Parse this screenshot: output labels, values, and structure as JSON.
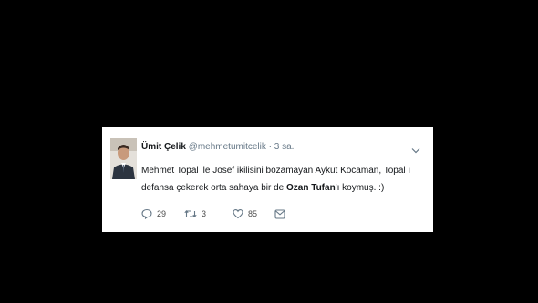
{
  "tweet": {
    "display_name": "Ümit Çelik",
    "handle": "@mehmetumitcelik",
    "separator": "·",
    "time": "3 sa.",
    "text_part1": "Mehmet Topal ile Josef ikilisini bozamayan Aykut Kocaman, Topal ı defansa çekerek orta sahaya bir de ",
    "text_bold": "Ozan Tufan",
    "text_part2": "'ı koymuş. :)",
    "reply_count": "29",
    "retweet_count": "3",
    "like_count": "85"
  },
  "icons": {
    "reply": "reply-icon",
    "retweet": "retweet-icon",
    "like": "heart-icon",
    "message": "direct-message-icon",
    "menu": "chevron-down-icon"
  },
  "colors": {
    "background": "#000000",
    "card": "#ffffff",
    "text": "#14171a",
    "secondary": "#657786"
  }
}
